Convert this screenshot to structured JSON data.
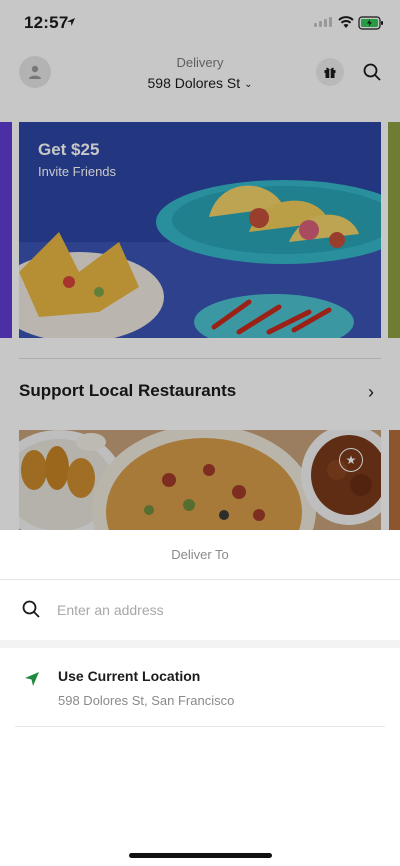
{
  "status_bar": {
    "time": "12:57"
  },
  "header": {
    "delivery_label": "Delivery",
    "address": "598 Dolores St"
  },
  "promo": {
    "title": "Get $25",
    "subtitle": "Invite Friends"
  },
  "section": {
    "title": "Support Local Restaurants"
  },
  "sheet": {
    "title": "Deliver To",
    "search_placeholder": "Enter an address",
    "current_location": {
      "title": "Use Current Location",
      "subtitle": "598 Dolores St, San Francisco"
    }
  },
  "colors": {
    "accent_green": "#1f8a3e",
    "promo_blue": "#2e47a6"
  }
}
